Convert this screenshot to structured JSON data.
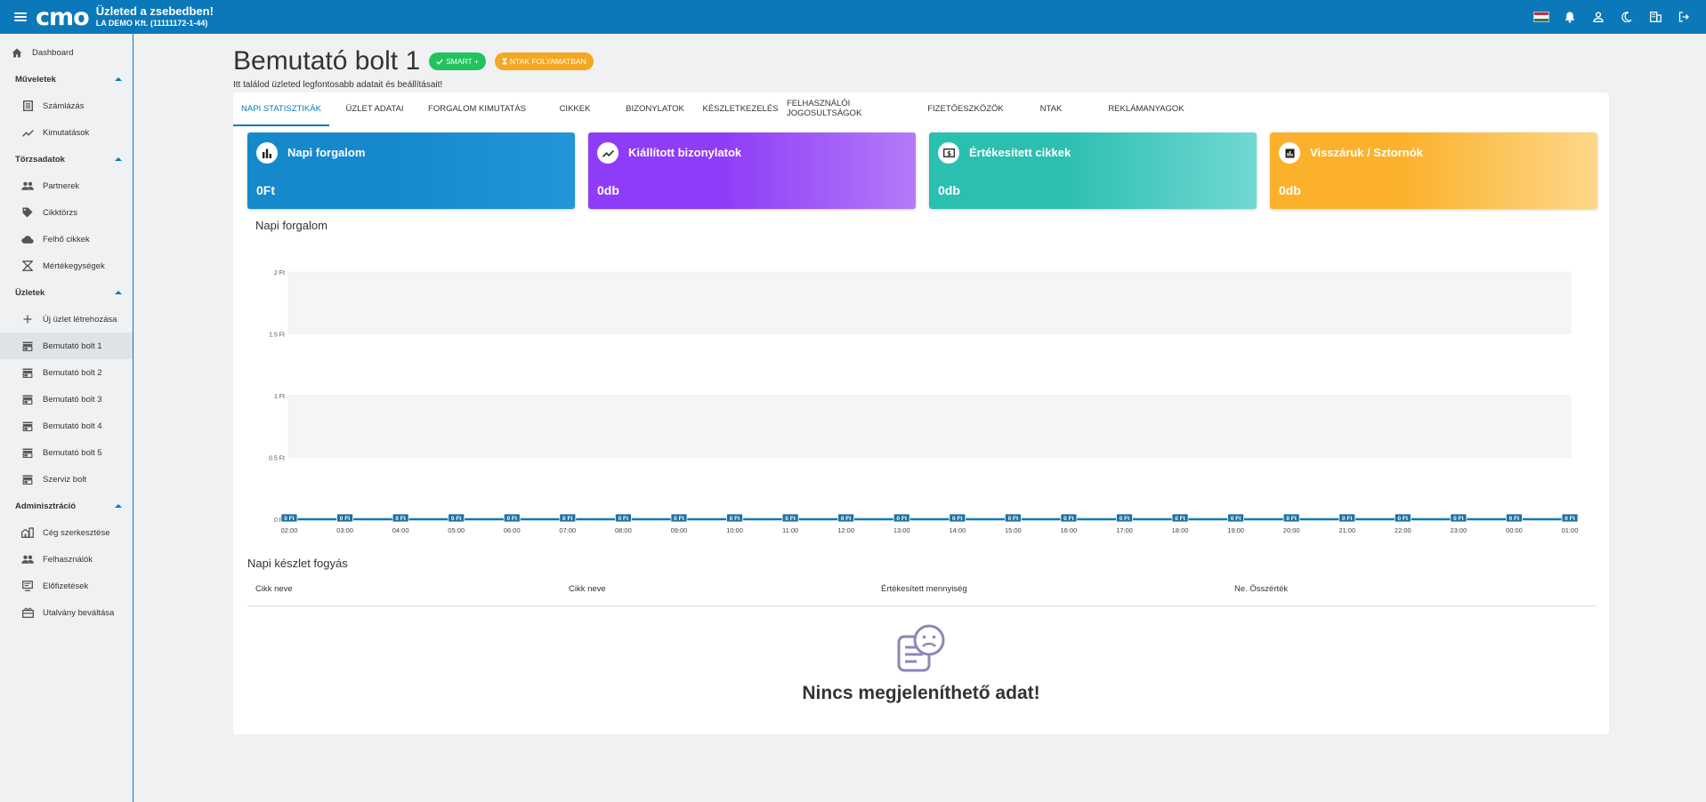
{
  "topbar": {
    "logo": "cmo",
    "title": "Üzleted a zsebedben!",
    "company": "LA DEMO Kft. (11111172-1-44)",
    "icons": [
      "hungarian-flag-icon",
      "bell-icon",
      "user-icon",
      "moon-icon",
      "building-icon",
      "logout-icon"
    ]
  },
  "sidebar": {
    "dashboard": "Dashboard",
    "sections": [
      {
        "title": "Műveletek",
        "items": [
          {
            "label": "Számlázás",
            "icon": "invoice-icon"
          },
          {
            "label": "Kimutatások",
            "icon": "trend-icon"
          }
        ]
      },
      {
        "title": "Törzsadatok",
        "items": [
          {
            "label": "Partnerek",
            "icon": "people-icon"
          },
          {
            "label": "Cikktörzs",
            "icon": "tag-icon"
          },
          {
            "label": "Felhő cikkek",
            "icon": "cloud-icon"
          },
          {
            "label": "Mértékegységek",
            "icon": "scale-icon"
          }
        ]
      },
      {
        "title": "Üzletek",
        "items": [
          {
            "label": "Új üzlet létrehozása",
            "icon": "plus-icon"
          },
          {
            "label": "Bemutató bolt 1",
            "icon": "store-icon",
            "active": true
          },
          {
            "label": "Bemutató bolt 2",
            "icon": "store-icon"
          },
          {
            "label": "Bemutató bolt 3",
            "icon": "store-icon"
          },
          {
            "label": "Bemutató bolt 4",
            "icon": "store-icon"
          },
          {
            "label": "Bemutató bolt 5",
            "icon": "store-icon"
          },
          {
            "label": "Szerviz bolt",
            "icon": "store-icon"
          }
        ]
      },
      {
        "title": "Adminisztráció",
        "items": [
          {
            "label": "Cég szerkesztése",
            "icon": "company-icon"
          },
          {
            "label": "Felhasználók",
            "icon": "people-icon"
          },
          {
            "label": "Előfizetések",
            "icon": "monitor-icon"
          },
          {
            "label": "Utalvány beváltása",
            "icon": "gift-icon"
          }
        ]
      }
    ]
  },
  "page": {
    "title": "Bemutató bolt 1",
    "badge_smart": "SMART +",
    "badge_ntak": "NTAK FOLYAMATBAN",
    "subtitle": "Itt találod üzleted legfontosabb adatait és beállításait!"
  },
  "tabs": [
    "NAPI STATISZTIKÁK",
    "ÜZLET ADATAI",
    "FORGALOM KIMUTATÁS",
    "CIKKEK",
    "BIZONYLATOK",
    "KÉSZLETKEZELÉS",
    "FELHASZNÁLÓI JOGOSULTSÁGOK",
    "FIZETŐESZKÖZÖK",
    "NTAK",
    "REKLÁMANYAGOK"
  ],
  "stats": [
    {
      "label": "Napi forgalom",
      "value": "0Ft",
      "icon": "bar-chart-icon",
      "color": "#1589cc"
    },
    {
      "label": "Kiállított bizonylatok",
      "value": "0db",
      "icon": "trend-icon",
      "color": "#8e3cf7"
    },
    {
      "label": "Értékesített cikkek",
      "value": "0db",
      "icon": "money-icon",
      "color": "#2bbfb0"
    },
    {
      "label": "Visszáruk / Sztornók",
      "value": "0db",
      "icon": "report-icon",
      "color": "#fbb12b"
    }
  ],
  "chart_title": "Napi forgalom",
  "chart_data": {
    "type": "line",
    "title": "Napi forgalom",
    "x": [
      "02:00",
      "03:00",
      "04:00",
      "05:00",
      "06:00",
      "07:00",
      "08:00",
      "09:00",
      "10:00",
      "11:00",
      "12:00",
      "13:00",
      "14:00",
      "15:00",
      "16:00",
      "17:00",
      "18:00",
      "19:00",
      "20:00",
      "21:00",
      "22:00",
      "23:00",
      "00:00",
      "01:00"
    ],
    "values": [
      0,
      0,
      0,
      0,
      0,
      0,
      0,
      0,
      0,
      0,
      0,
      0,
      0,
      0,
      0,
      0,
      0,
      0,
      0,
      0,
      0,
      0,
      0,
      0
    ],
    "point_labels": [
      "0 Ft",
      "0 Ft",
      "0 Ft",
      "0 Ft",
      "0 Ft",
      "0 Ft",
      "0 Ft",
      "0 Ft",
      "0 Ft",
      "0 Ft",
      "0 Ft",
      "0 Ft",
      "0 Ft",
      "0 Ft",
      "0 Ft",
      "0 Ft",
      "0 Ft",
      "0 Ft",
      "0 Ft",
      "0 Ft",
      "0 Ft",
      "0 Ft",
      "0 Ft",
      "0 Ft"
    ],
    "y_ticks": [
      "0 Ft",
      "0.5 Ft",
      "1 Ft",
      "1.5 Ft",
      "2 Ft"
    ],
    "ylim": [
      0,
      2
    ],
    "color": "#0b79b9"
  },
  "stock_section": {
    "title": "Napi készlet fogyás",
    "columns": [
      "Cikk neve",
      "Cikk neve",
      "Értékesített mennyiség",
      "Ne. Összérték"
    ],
    "empty_text": "Nincs megjeleníthető adat!"
  }
}
